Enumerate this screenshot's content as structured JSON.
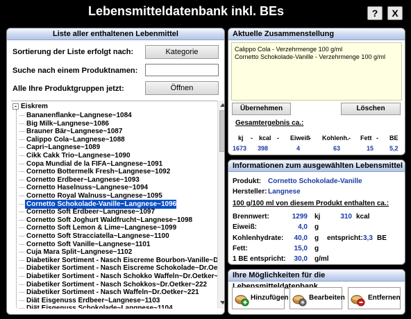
{
  "window": {
    "title": "Lebensmitteldatenbank inkl. BEs",
    "help_label": "?",
    "close_label": "X"
  },
  "list_panel": {
    "header": "Liste aller enthaltenen Lebenmittel",
    "sort_label": "Sortierung der Liste erfolgt nach:",
    "sort_button": "Kategorie",
    "search_label": "Suche nach einem Produktnamen:",
    "search_value": "",
    "groups_label": "Alle Ihre Produktgruppen jetzt:",
    "open_button": "Öffnen",
    "tree_root": "Eiskrem",
    "tree_root_toggle": "-",
    "items": [
      "Bananenflanke~Langnese~1084",
      "Big Milk~Langnese~1086",
      "Brauner Bär~Langnese~1087",
      "Calippo Cola~Langnese~1088",
      "Capri~Langnese~1089",
      "Cikk Cakk Trio~Langnese~1090",
      "Copa Mundial de la FIFA~Langnese~1091",
      "Cornetto Bottermelk Fresh~Langnese~1092",
      "Cornetto Erdbeer~Langnese~1093",
      "Cornetto Haselnuss~Langnese~1094",
      "Cornetto Royal Walnuss~Langnese~1095",
      "Cornetto Schokolade-Vanille~Langnese~1096",
      "Cornetto Soft Erdbeer~Langnese~1097",
      "Cornetto Soft Joghurt Waldfrucht~Langnese~1098",
      "Cornetto Soft Lemon & Lime~Langnese~1099",
      "Cornetto Soft Stracciatella~Langnese~1100",
      "Cornetto Soft Vanille~Langnese~1101",
      "Cuja Mara Split~Langnese~1102",
      "Diabetiker Sortiment - Nasch Eiscreme Bourbon-Vanille~Dr.Oetker~",
      "Diabetiker Sortiment - Nasch Eiscreme Schokolade~Dr.Oetker~224",
      "Diabetiker Sortiment - Nasch Schokko Waffeln~Dr.Oetker~220",
      "Diabetiker Sortiment - Nasch Schokkos~Dr.Oetker~222",
      "Diabetiker Sortiment - Nasch Waffeln~Dr.Oetker~221",
      "Diät Eisgenuss Erdbeer~Langnese~1103",
      "Diät Eisgenuss Schokolade~Langnese~1104"
    ],
    "selected_index": 11
  },
  "compilation_panel": {
    "header": "Aktuelle Zusammenstellung",
    "entries": [
      "Calippo Cola - Verzehrmenge 100 g/ml",
      "Cornetto Schokolade-Vanille - Verzehrmenge 100 g/ml"
    ],
    "apply_button": "Übernehmen",
    "delete_button": "Löschen",
    "total_label": "Gesamtergebnis ca.:",
    "columns": [
      "kj",
      "-",
      "kcal",
      "-",
      "Eiweiß",
      "-",
      "Kohlenh.",
      "-",
      "Fett",
      "-",
      "BE"
    ],
    "values": [
      "1673",
      "398",
      "4",
      "63",
      "15",
      "5,2"
    ]
  },
  "info_panel": {
    "header": "Informationen zum ausgewählten Lebensmittel",
    "product_label": "Produkt:",
    "product_value": "Cornetto Schokolade-Vanille",
    "manufacturer_label": "Hersteller:",
    "manufacturer_value": "Langnese",
    "per_label": "100 g/100 ml von diesem Produkt enthalten ca.:",
    "brennwert_label": "Brennwert:",
    "brennwert_kj": "1299",
    "kj_unit": "kj",
    "brennwert_kcal": "310",
    "kcal_unit": "kcal",
    "eiweiss_label": "Eiweiß:",
    "eiweiss_value": "4,0",
    "g_unit": "g",
    "kh_label": "Kohlenhydrate:",
    "kh_value": "40,0",
    "entspricht_label": "entspricht:",
    "be_value": "3,3",
    "be_unit": "BE",
    "fett_label": "Fett:",
    "fett_value": "15,0",
    "be_entspricht_label": "1 BE entspricht:",
    "be_entspricht_value": "30,0",
    "gml_unit": "g/ml"
  },
  "actions_panel": {
    "header": "Ihre Möglichkeiten für die Lebensmitteldatenbank",
    "add_button": "Hinzufügen",
    "edit_button": "Bearbeiten",
    "remove_button": "Entfernen"
  },
  "colors": {
    "accent_blue": "#1a3aa6",
    "selection": "#0a4fc4",
    "compilation_bg": "#ffffe1"
  }
}
